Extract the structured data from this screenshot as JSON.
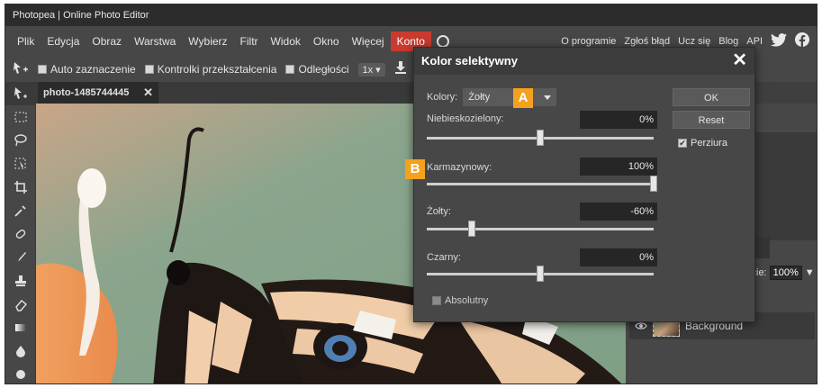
{
  "window": {
    "title": "Photopea | Online Photo Editor"
  },
  "menu": {
    "items": [
      "Plik",
      "Edycja",
      "Obraz",
      "Warstwa",
      "Wybierz",
      "Filtr",
      "Widok",
      "Okno",
      "Więcej",
      "Konto"
    ],
    "right_items": [
      "O programie",
      "Zgłoś błąd",
      "Ucz się",
      "Blog",
      "API"
    ],
    "active_color": "#c93a2f"
  },
  "options_bar": {
    "auto_select_label": "Auto zaznaczenie",
    "transform_controls_label": "Kontrolki przekształcenia",
    "distances_label": "Odległości",
    "zoom_value": "1x"
  },
  "document": {
    "tab_name": "photo-1485744445",
    "close_glyph": "✕"
  },
  "layers_panel": {
    "opacity_label": "ycie:",
    "opacity_value": "100%",
    "layer_name": "Background"
  },
  "dialog": {
    "title": "Kolor selektywny",
    "colors_label": "Kolory:",
    "colors_value": "Żołty",
    "marker_a": "A",
    "marker_b": "B",
    "sliders": [
      {
        "label": "Niebieskozielony:",
        "value_text": "0%",
        "percent": 0
      },
      {
        "label": "Karmazynowy:",
        "value_text": "100%",
        "percent": 100
      },
      {
        "label": "Żołty:",
        "value_text": "-60%",
        "percent": -60
      },
      {
        "label": "Czarny:",
        "value_text": "0%",
        "percent": 0
      }
    ],
    "ok_label": "OK",
    "reset_label": "Reset",
    "preview_label": "Perziura",
    "preview_checked": true,
    "absolute_label": "Absolutny",
    "absolute_checked": false,
    "marker_color": "#f4a11d"
  }
}
